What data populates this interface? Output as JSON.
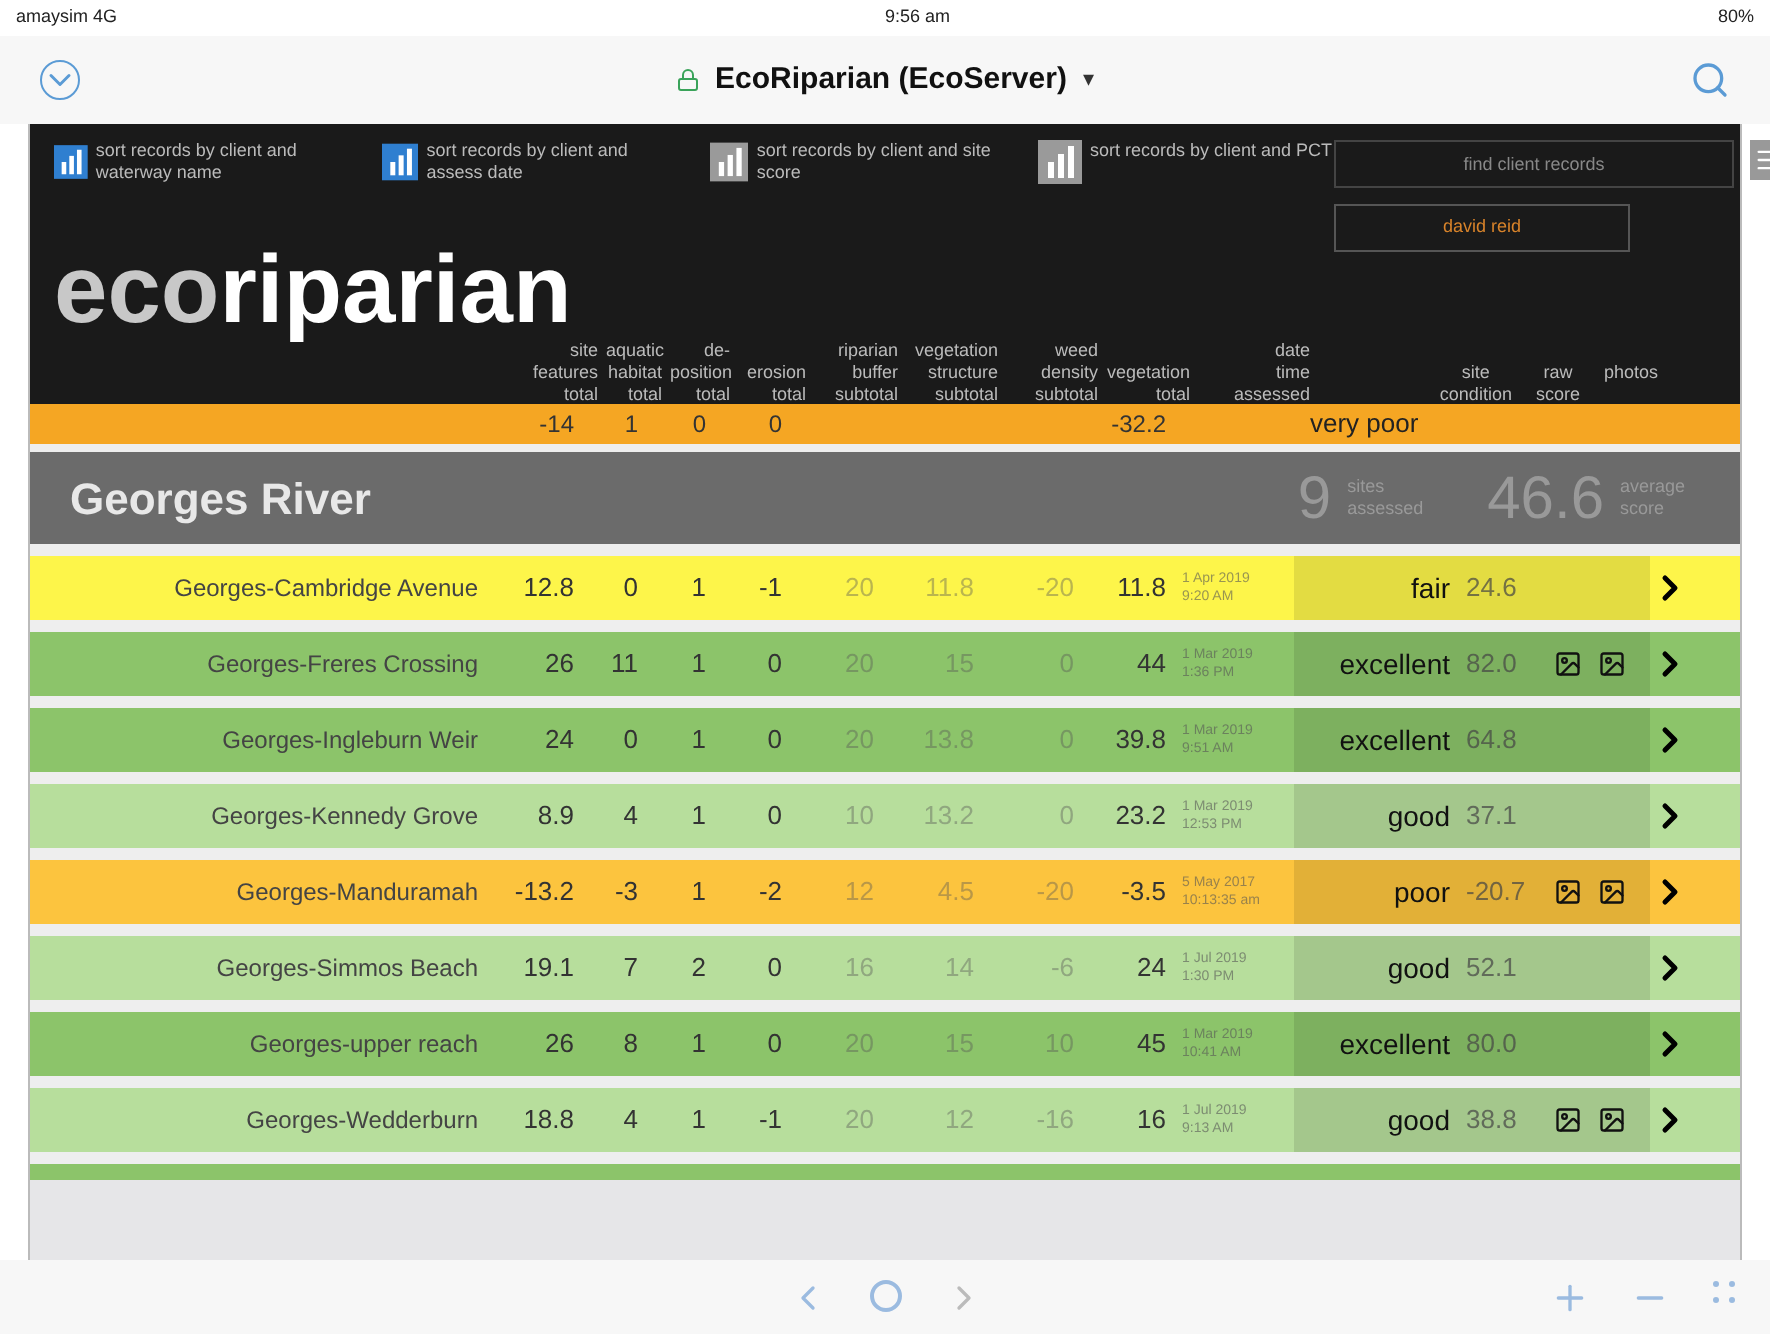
{
  "status_bar": {
    "carrier": "amaysim 4G",
    "time": "9:56 am",
    "battery": "80%"
  },
  "browser": {
    "title": "EcoRiparian (EcoServer)",
    "caret": "▾"
  },
  "header": {
    "sort_buttons": [
      {
        "label": "sort records by client and waterway name",
        "color": "#2f7fd0"
      },
      {
        "label": "sort records by client and assess date",
        "color": "#2f7fd0"
      },
      {
        "label": "sort records by client and site score",
        "color": "#9a9a9a"
      },
      {
        "label": "sort records by client and PCT",
        "color": "#9a9a9a"
      }
    ],
    "search": {
      "placeholder": "find client records"
    },
    "user_button": "david reid",
    "logo": {
      "light": "eco",
      "bold": "riparian"
    },
    "columns": [
      "site\nfeatures\ntotal",
      "aquatic\nhabitat\ntotal",
      "de-\nposition\ntotal",
      "erosion\ntotal",
      "riparian\nbuffer\nsubtotal",
      "vegetation\nstructure\nsubtotal",
      "weed\ndensity\nsubtotal",
      "vegetation\ntotal",
      "date\ntime\nassessed",
      "site\ncondition",
      "raw\nscore",
      "photos"
    ]
  },
  "partial_row": {
    "color": "#f5a623",
    "values": [
      "-14",
      "1",
      "0",
      "0"
    ],
    "vegetation_total": "-32.2",
    "condition": "very poor"
  },
  "group": {
    "name": "Georges River",
    "sites": "9",
    "sites_label": "sites assessed",
    "average": "46.6",
    "average_label": "average score"
  },
  "rows": [
    {
      "name": "Georges-Cambridge Avenue",
      "values": [
        "12.8",
        "0",
        "1",
        "-1",
        "20",
        "11.8",
        "-20",
        "11.8"
      ],
      "date": "1 Apr 2019",
      "time": "9:20 AM",
      "condition": "fair",
      "score": "24.6",
      "photos": false,
      "color": "#fdf54a"
    },
    {
      "name": "Georges-Freres Crossing",
      "values": [
        "26",
        "11",
        "1",
        "0",
        "20",
        "15",
        "0",
        "44"
      ],
      "date": "1 Mar 2019",
      "time": "1:36 PM",
      "condition": "excellent",
      "score": "82.0",
      "photos": true,
      "color": "#8cc46a"
    },
    {
      "name": "Georges-Ingleburn Weir",
      "values": [
        "24",
        "0",
        "1",
        "0",
        "20",
        "13.8",
        "0",
        "39.8"
      ],
      "date": "1 Mar 2019",
      "time": "9:51 AM",
      "condition": "excellent",
      "score": "64.8",
      "photos": false,
      "color": "#8cc46a"
    },
    {
      "name": "Georges-Kennedy Grove",
      "values": [
        "8.9",
        "4",
        "1",
        "0",
        "10",
        "13.2",
        "0",
        "23.2"
      ],
      "date": "1 Mar 2019",
      "time": "12:53 PM",
      "condition": "good",
      "score": "37.1",
      "photos": false,
      "color": "#b7de9c"
    },
    {
      "name": "Georges-Manduramah",
      "values": [
        "-13.2",
        "-3",
        "1",
        "-2",
        "12",
        "4.5",
        "-20",
        "-3.5"
      ],
      "date": "5 May 2017",
      "time": "10:13:35 am",
      "condition": "poor",
      "score": "-20.7",
      "photos": true,
      "color": "#fcc43e"
    },
    {
      "name": "Georges-Simmos Beach",
      "values": [
        "19.1",
        "7",
        "2",
        "0",
        "16",
        "14",
        "-6",
        "24"
      ],
      "date": "1 Jul 2019",
      "time": "1:30 PM",
      "condition": "good",
      "score": "52.1",
      "photos": false,
      "color": "#b7de9c"
    },
    {
      "name": "Georges-upper  reach",
      "values": [
        "26",
        "8",
        "1",
        "0",
        "20",
        "15",
        "10",
        "45"
      ],
      "date": "1 Mar 2019",
      "time": "10:41 AM",
      "condition": "excellent",
      "score": "80.0",
      "photos": false,
      "color": "#8cc46a"
    },
    {
      "name": "Georges-Wedderburn",
      "values": [
        "18.8",
        "4",
        "1",
        "-1",
        "20",
        "12",
        "-16",
        "16"
      ],
      "date": "1 Jul 2019",
      "time": "9:13 AM",
      "condition": "good",
      "score": "38.8",
      "photos": true,
      "color": "#b7de9c"
    }
  ],
  "partial_row_bottom": {
    "color": "#8cc46a"
  }
}
